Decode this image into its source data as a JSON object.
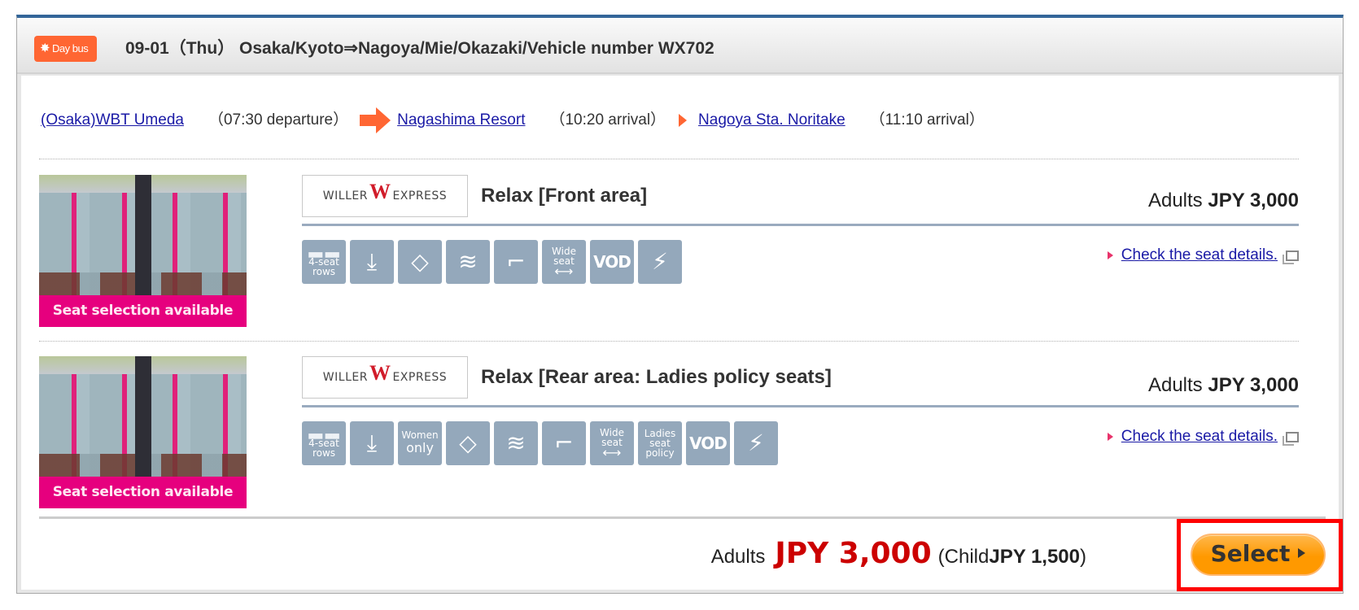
{
  "header": {
    "badge_label": "Day bus",
    "badge_icon": "sun-icon",
    "title": "09-01（Thu） Osaka/Kyoto⇒Nagoya/Mie/Okazaki/Vehicle number WX702"
  },
  "route": {
    "stops": [
      {
        "name": "(Osaka)WBT Umeda",
        "time": "（07:30 departure）"
      },
      {
        "name": "Nagashima Resort",
        "time": "（10:20 arrival）"
      },
      {
        "name": "Nagoya Sta. Noritake",
        "time": "（11:10 arrival）"
      }
    ]
  },
  "plans": [
    {
      "photo_caption": "Seat selection available",
      "operator_logo": {
        "left": "WILLER",
        "mark": "W",
        "right": "EXPRESS"
      },
      "title": "Relax [Front area]",
      "price_label": "Adults",
      "price": "JPY 3,000",
      "details_link": "Check the seat details.",
      "features": [
        {
          "icon": "four-seat-rows-icon",
          "lines": [
            "4-seat",
            "rows"
          ]
        },
        {
          "icon": "reclining-seat-icon"
        },
        {
          "icon": "blanket-icon"
        },
        {
          "icon": "wifi-icon"
        },
        {
          "icon": "leg-rest-icon"
        },
        {
          "icon": "wide-seat-icon",
          "lines": [
            "Wide",
            "seat"
          ]
        },
        {
          "icon": "vod-icon",
          "text": "VOD"
        },
        {
          "icon": "power-outlet-icon"
        }
      ]
    },
    {
      "photo_caption": "Seat selection available",
      "operator_logo": {
        "left": "WILLER",
        "mark": "W",
        "right": "EXPRESS"
      },
      "title": "Relax [Rear area: Ladies policy seats]",
      "price_label": "Adults",
      "price": "JPY 3,000",
      "details_link": "Check the seat details.",
      "features": [
        {
          "icon": "four-seat-rows-icon",
          "lines": [
            "4-seat",
            "rows"
          ]
        },
        {
          "icon": "reclining-seat-icon"
        },
        {
          "icon": "women-only-icon",
          "lines": [
            "Women",
            "only"
          ]
        },
        {
          "icon": "blanket-icon"
        },
        {
          "icon": "wifi-icon"
        },
        {
          "icon": "leg-rest-icon"
        },
        {
          "icon": "wide-seat-icon",
          "lines": [
            "Wide",
            "seat"
          ]
        },
        {
          "icon": "ladies-seat-policy-icon",
          "lines": [
            "Ladies",
            "seat",
            "policy"
          ]
        },
        {
          "icon": "vod-icon",
          "text": "VOD"
        },
        {
          "icon": "power-outlet-icon"
        }
      ]
    }
  ],
  "footer": {
    "adults_label": "Adults",
    "adults_price": "JPY 3,000",
    "child_open": "(Child ",
    "child_price": "JPY 1,500",
    "child_close": ")",
    "select_label": "Select"
  },
  "colors": {
    "accent_blue": "#336699",
    "badge_orange": "#ff6633",
    "price_red": "#cc0000",
    "select_orange": "#ff9900",
    "caption_magenta": "#e6007e",
    "highlight_red": "#ff0000",
    "link_blue": "#1a1aa6",
    "feature_icon_gray": "#94a8bb"
  }
}
